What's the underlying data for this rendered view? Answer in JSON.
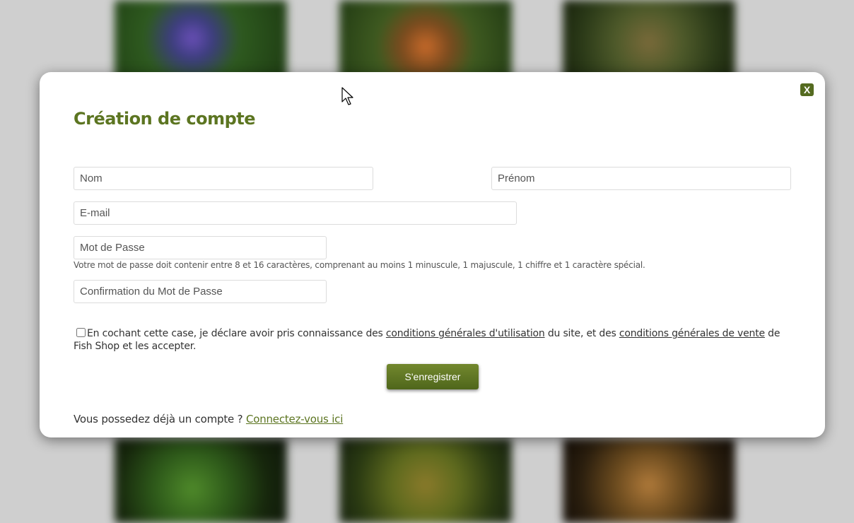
{
  "modal": {
    "close_label": "X",
    "title": "Création de compte"
  },
  "form": {
    "nom_placeholder": "Nom",
    "prenom_placeholder": "Prénom",
    "email_placeholder": "E-mail",
    "password_placeholder": "Mot de Passe",
    "password_hint": "Votre mot de passe doit contenir entre 8 et 16 caractères, comprenant au moins 1 minuscule, 1 majuscule, 1 chiffre et 1 caractère spécial.",
    "confirm_placeholder": "Confirmation du Mot de Passe",
    "terms": {
      "checked": false,
      "text_before": "En cochant cette case, je déclare avoir pris connaissance des ",
      "cgu_link": "conditions générales d'utilisation",
      "text_middle": " du site, et des ",
      "cgv_link": "conditions générales de vente",
      "text_after": " de Fish Shop et les accepter."
    },
    "submit_label": "S'enregistrer"
  },
  "login": {
    "prompt": "Vous possedez déjà un compte ? ",
    "link": "Connectez-vous ici"
  },
  "colors": {
    "accent": "#5c7521",
    "button_top": "#73882e",
    "button_bottom": "#4f661b",
    "backdrop": "#cfcfcf"
  },
  "icons": {
    "close": "close-icon",
    "cursor": "mouse-pointer-icon"
  }
}
